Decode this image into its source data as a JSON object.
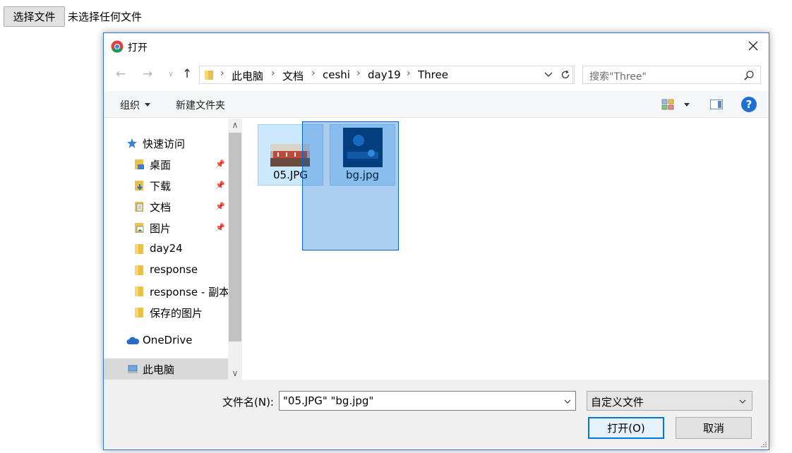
{
  "page": {
    "file_button_label": "选择文件",
    "file_status": "未选择任何文件"
  },
  "dialog": {
    "title": "打开",
    "breadcrumbs": [
      "此电脑",
      "文档",
      "ceshi",
      "day19",
      "Three"
    ],
    "search_placeholder": "搜索\"Three\"",
    "toolbar": {
      "organize_label": "组织",
      "new_folder_label": "新建文件夹"
    },
    "nav_pane": {
      "quick_access": "快速访问",
      "items": [
        {
          "label": "桌面",
          "icon": "desktop-folder-icon",
          "pinned": true
        },
        {
          "label": "下载",
          "icon": "downloads-folder-icon",
          "pinned": true
        },
        {
          "label": "文档",
          "icon": "documents-folder-icon",
          "pinned": true
        },
        {
          "label": "图片",
          "icon": "pictures-folder-icon",
          "pinned": true
        },
        {
          "label": "day24",
          "icon": "folder-icon",
          "pinned": false
        },
        {
          "label": "response",
          "icon": "folder-icon",
          "pinned": false
        },
        {
          "label": "response - 副本",
          "icon": "folder-icon",
          "pinned": false
        },
        {
          "label": "保存的图片",
          "icon": "folder-icon",
          "pinned": false
        }
      ],
      "onedrive": "OneDrive",
      "this_pc": "此电脑"
    },
    "files": [
      {
        "name": "05.JPG",
        "selected": true
      },
      {
        "name": "bg.jpg",
        "selected": true
      }
    ],
    "bottom": {
      "filename_label": "文件名(N):",
      "filename_value": "\"05.JPG\" \"bg.jpg\"",
      "filetype_value": "自定义文件",
      "open_button": "打开(O)",
      "cancel_button": "取消"
    }
  },
  "colors": {
    "accent": "#0078d7",
    "selection_fill": "#cce8ff",
    "marquee_fill": "#0066cc",
    "folder_yellow": "#e8c04a"
  }
}
